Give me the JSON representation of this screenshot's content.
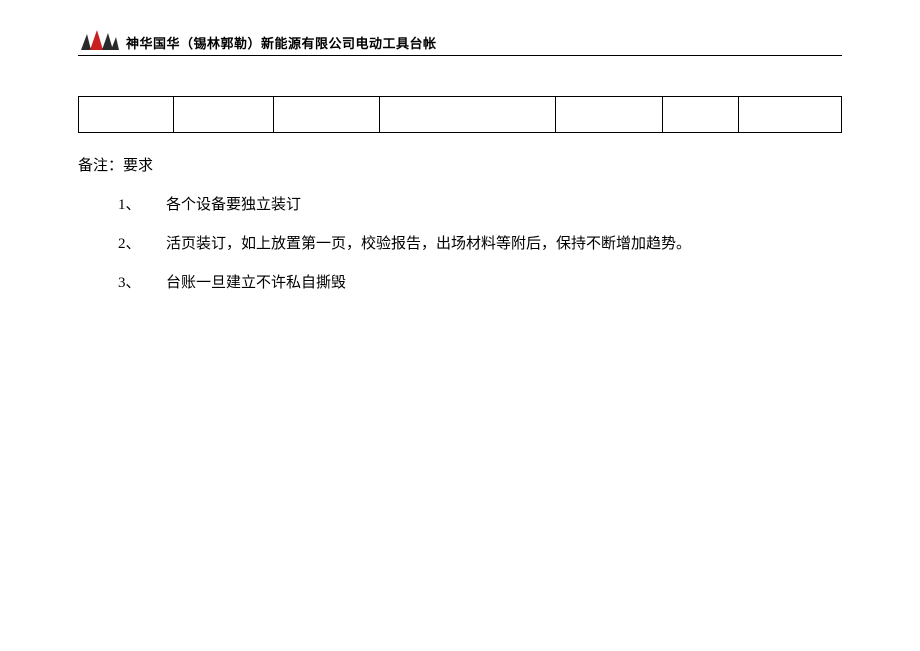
{
  "header": {
    "title": "神华国华（锡林郭勒）新能源有限公司电动工具台帐"
  },
  "table": {
    "columns": 7,
    "rows": 1,
    "cells": [
      "",
      "",
      "",
      "",
      "",
      "",
      ""
    ]
  },
  "notes": {
    "title": "备注：要求",
    "items": [
      {
        "number": "1、",
        "text": "各个设备要独立装订"
      },
      {
        "number": "2、",
        "text": " 活页装订，如上放置第一页，校验报告，出场材料等附后，保持不断增加趋势。"
      },
      {
        "number": "3、",
        "text": "台账一旦建立不许私自撕毁"
      }
    ]
  }
}
